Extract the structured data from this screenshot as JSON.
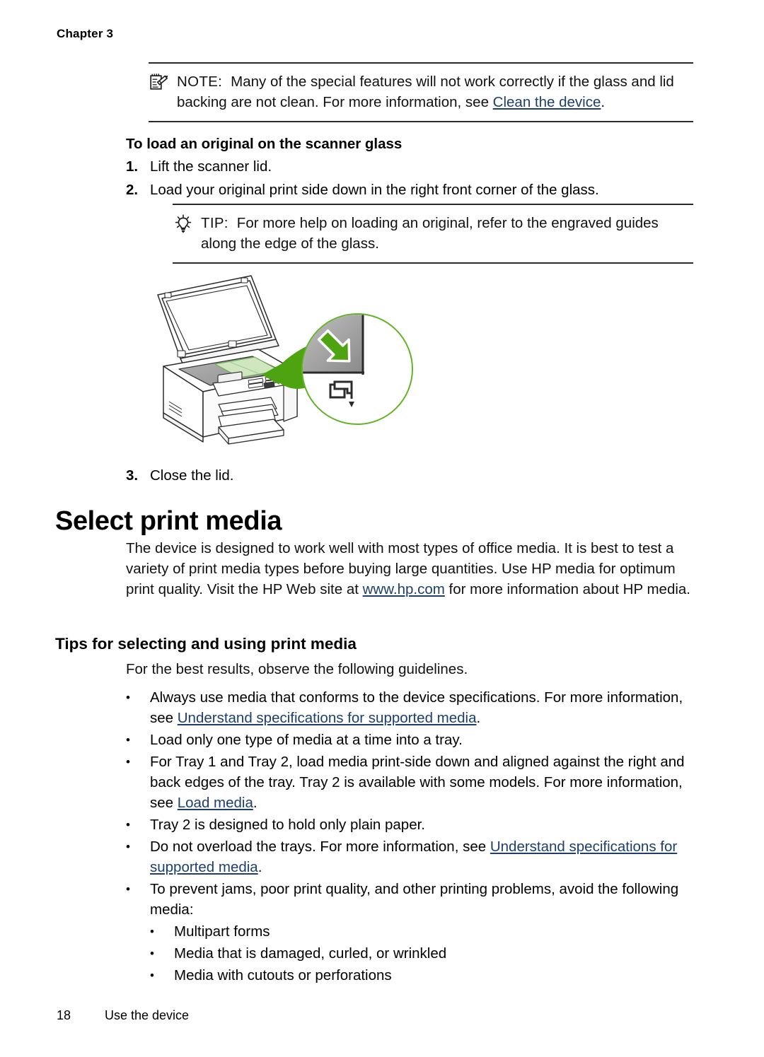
{
  "header": {
    "chapter": "Chapter 3"
  },
  "note": {
    "icon": "note-pad-pencil-icon",
    "label": "NOTE:",
    "text_before": "Many of the special features will not work correctly if the glass and lid backing are not clean. For more information, see ",
    "link": "Clean the device",
    "text_after": "."
  },
  "procedure": {
    "heading": "To load an original on the scanner glass",
    "steps": [
      {
        "num": "1.",
        "text": "Lift the scanner lid."
      },
      {
        "num": "2.",
        "text": "Load your original print side down in the right front corner of the glass."
      }
    ],
    "final_step": {
      "num": "3.",
      "text": "Close the lid."
    }
  },
  "tip": {
    "icon": "lightbulb-icon",
    "label": "TIP:",
    "text": "For more help on loading an original, refer to the engraved guides along the edge of the glass."
  },
  "illustration": {
    "name": "scanner-load-original-illustration",
    "alt": "All-in-one printer with scanner lid open, original placed on glass, magnified callout showing right front corner alignment",
    "accent_color": "#4da410",
    "glass_color": "#9e9e9e",
    "document_color": "#cfe6c1"
  },
  "section": {
    "title": "Select print media",
    "intro": {
      "text_before": "The device is designed to work well with most types of office media. It is best to test a variety of print media types before buying large quantities. Use HP media for optimum print quality. Visit the HP Web site at ",
      "link": "www.hp.com",
      "text_after": " for more information about HP media."
    }
  },
  "tips": {
    "heading": "Tips for selecting and using print media",
    "intro": "For the best results, observe the following guidelines.",
    "bullet_marker": "•",
    "items": [
      {
        "text_before": "Always use media that conforms to the device specifications. For more information, see ",
        "link": "Understand specifications for supported media",
        "text_after": "."
      },
      {
        "text_before": "Load only one type of media at a time into a tray.",
        "link": "",
        "text_after": ""
      },
      {
        "text_before": "For Tray 1 and Tray 2, load media print-side down and aligned against the right and back edges of the tray. Tray 2 is available with some models. For more information, see ",
        "link": "Load media",
        "text_after": "."
      },
      {
        "text_before": "Tray 2 is designed to hold only plain paper.",
        "link": "",
        "text_after": ""
      },
      {
        "text_before": "Do not overload the trays. For more information, see ",
        "link": "Understand specifications for supported media",
        "text_after": "."
      },
      {
        "text_before": "To prevent jams, poor print quality, and other printing problems, avoid the following media:",
        "link": "",
        "text_after": ""
      }
    ],
    "subitems": [
      "Multipart forms",
      "Media that is damaged, curled, or wrinkled",
      "Media with cutouts or perforations"
    ]
  },
  "footer": {
    "page_number": "18",
    "title": "Use the device"
  },
  "colors": {
    "link": "#1c3f6e",
    "text": "#111111",
    "rule": "#2a2a2a",
    "accent_green": "#4da410"
  }
}
